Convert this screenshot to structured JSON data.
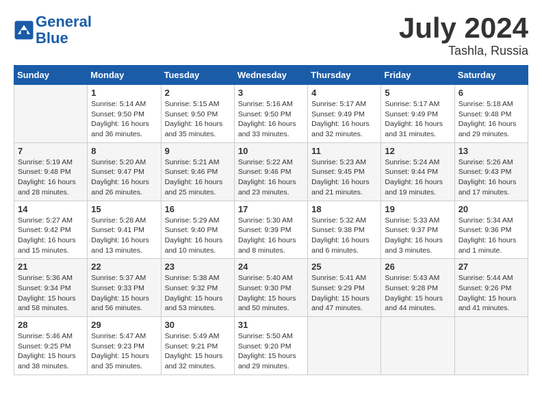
{
  "header": {
    "logo_line1": "General",
    "logo_line2": "Blue",
    "month_year": "July 2024",
    "location": "Tashla, Russia"
  },
  "weekdays": [
    "Sunday",
    "Monday",
    "Tuesday",
    "Wednesday",
    "Thursday",
    "Friday",
    "Saturday"
  ],
  "weeks": [
    [
      {
        "day": "",
        "info": ""
      },
      {
        "day": "1",
        "info": "Sunrise: 5:14 AM\nSunset: 9:50 PM\nDaylight: 16 hours\nand 36 minutes."
      },
      {
        "day": "2",
        "info": "Sunrise: 5:15 AM\nSunset: 9:50 PM\nDaylight: 16 hours\nand 35 minutes."
      },
      {
        "day": "3",
        "info": "Sunrise: 5:16 AM\nSunset: 9:50 PM\nDaylight: 16 hours\nand 33 minutes."
      },
      {
        "day": "4",
        "info": "Sunrise: 5:17 AM\nSunset: 9:49 PM\nDaylight: 16 hours\nand 32 minutes."
      },
      {
        "day": "5",
        "info": "Sunrise: 5:17 AM\nSunset: 9:49 PM\nDaylight: 16 hours\nand 31 minutes."
      },
      {
        "day": "6",
        "info": "Sunrise: 5:18 AM\nSunset: 9:48 PM\nDaylight: 16 hours\nand 29 minutes."
      }
    ],
    [
      {
        "day": "7",
        "info": "Sunrise: 5:19 AM\nSunset: 9:48 PM\nDaylight: 16 hours\nand 28 minutes."
      },
      {
        "day": "8",
        "info": "Sunrise: 5:20 AM\nSunset: 9:47 PM\nDaylight: 16 hours\nand 26 minutes."
      },
      {
        "day": "9",
        "info": "Sunrise: 5:21 AM\nSunset: 9:46 PM\nDaylight: 16 hours\nand 25 minutes."
      },
      {
        "day": "10",
        "info": "Sunrise: 5:22 AM\nSunset: 9:46 PM\nDaylight: 16 hours\nand 23 minutes."
      },
      {
        "day": "11",
        "info": "Sunrise: 5:23 AM\nSunset: 9:45 PM\nDaylight: 16 hours\nand 21 minutes."
      },
      {
        "day": "12",
        "info": "Sunrise: 5:24 AM\nSunset: 9:44 PM\nDaylight: 16 hours\nand 19 minutes."
      },
      {
        "day": "13",
        "info": "Sunrise: 5:26 AM\nSunset: 9:43 PM\nDaylight: 16 hours\nand 17 minutes."
      }
    ],
    [
      {
        "day": "14",
        "info": "Sunrise: 5:27 AM\nSunset: 9:42 PM\nDaylight: 16 hours\nand 15 minutes."
      },
      {
        "day": "15",
        "info": "Sunrise: 5:28 AM\nSunset: 9:41 PM\nDaylight: 16 hours\nand 13 minutes."
      },
      {
        "day": "16",
        "info": "Sunrise: 5:29 AM\nSunset: 9:40 PM\nDaylight: 16 hours\nand 10 minutes."
      },
      {
        "day": "17",
        "info": "Sunrise: 5:30 AM\nSunset: 9:39 PM\nDaylight: 16 hours\nand 8 minutes."
      },
      {
        "day": "18",
        "info": "Sunrise: 5:32 AM\nSunset: 9:38 PM\nDaylight: 16 hours\nand 6 minutes."
      },
      {
        "day": "19",
        "info": "Sunrise: 5:33 AM\nSunset: 9:37 PM\nDaylight: 16 hours\nand 3 minutes."
      },
      {
        "day": "20",
        "info": "Sunrise: 5:34 AM\nSunset: 9:36 PM\nDaylight: 16 hours\nand 1 minute."
      }
    ],
    [
      {
        "day": "21",
        "info": "Sunrise: 5:36 AM\nSunset: 9:34 PM\nDaylight: 15 hours\nand 58 minutes."
      },
      {
        "day": "22",
        "info": "Sunrise: 5:37 AM\nSunset: 9:33 PM\nDaylight: 15 hours\nand 56 minutes."
      },
      {
        "day": "23",
        "info": "Sunrise: 5:38 AM\nSunset: 9:32 PM\nDaylight: 15 hours\nand 53 minutes."
      },
      {
        "day": "24",
        "info": "Sunrise: 5:40 AM\nSunset: 9:30 PM\nDaylight: 15 hours\nand 50 minutes."
      },
      {
        "day": "25",
        "info": "Sunrise: 5:41 AM\nSunset: 9:29 PM\nDaylight: 15 hours\nand 47 minutes."
      },
      {
        "day": "26",
        "info": "Sunrise: 5:43 AM\nSunset: 9:28 PM\nDaylight: 15 hours\nand 44 minutes."
      },
      {
        "day": "27",
        "info": "Sunrise: 5:44 AM\nSunset: 9:26 PM\nDaylight: 15 hours\nand 41 minutes."
      }
    ],
    [
      {
        "day": "28",
        "info": "Sunrise: 5:46 AM\nSunset: 9:25 PM\nDaylight: 15 hours\nand 38 minutes."
      },
      {
        "day": "29",
        "info": "Sunrise: 5:47 AM\nSunset: 9:23 PM\nDaylight: 15 hours\nand 35 minutes."
      },
      {
        "day": "30",
        "info": "Sunrise: 5:49 AM\nSunset: 9:21 PM\nDaylight: 15 hours\nand 32 minutes."
      },
      {
        "day": "31",
        "info": "Sunrise: 5:50 AM\nSunset: 9:20 PM\nDaylight: 15 hours\nand 29 minutes."
      },
      {
        "day": "",
        "info": ""
      },
      {
        "day": "",
        "info": ""
      },
      {
        "day": "",
        "info": ""
      }
    ]
  ]
}
